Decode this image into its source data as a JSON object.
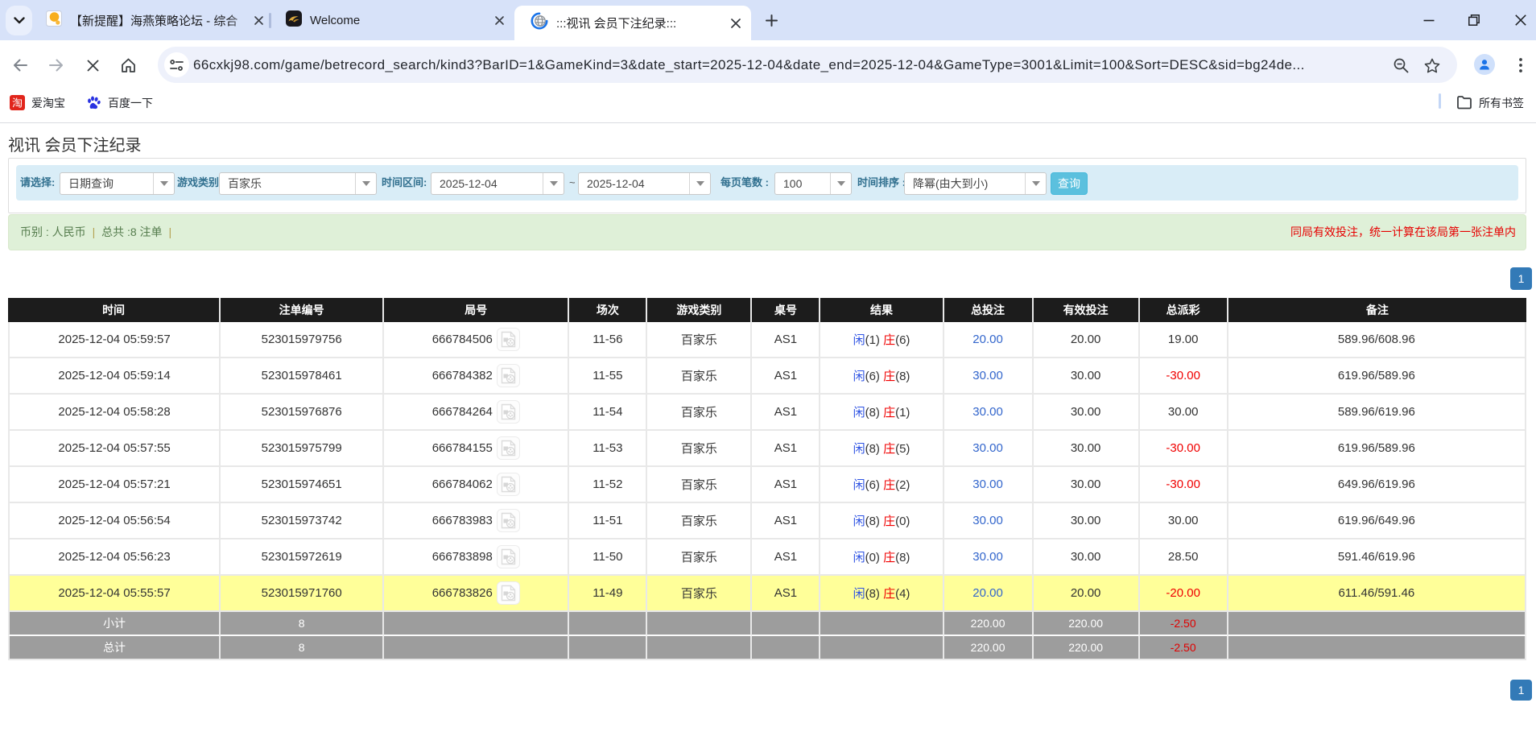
{
  "colors": {
    "tabstrip_bg": "#d7e2f9",
    "accent_blue": "#337ab7",
    "search_button_blue": "#5bc0de",
    "filter_bg": "#d9edf7",
    "summary_bg": "#dff0d8",
    "table_header_bg": "#1c1c1c",
    "highlight_row": "#ffff99",
    "footer_row_bg": "#9d9d9d",
    "link_blue": "#3366cc",
    "negative_red": "#f00000",
    "player_blue": "#2e53e3",
    "banker_red": "#f00000"
  },
  "browser": {
    "tabs": [
      {
        "title": "【新提醒】海燕策略论坛 - 综合",
        "favicon": "haiyan-forum-icon",
        "active": false
      },
      {
        "title": "Welcome",
        "favicon": "gold-dragon-icon",
        "active": false
      },
      {
        "title": ":::视讯 会员下注纪录:::",
        "favicon": "loading-spinner-globe-icon",
        "active": true
      }
    ],
    "url": "66cxkj98.com/game/betrecord_search/kind3?BarID=1&GameKind=3&date_start=2025-12-04&date_end=2025-12-04&GameType=3001&Limit=100&Sort=DESC&sid=bg24de...",
    "bookmarks": [
      {
        "label": "爱淘宝",
        "icon": "taobao-icon"
      },
      {
        "label": "百度一下",
        "icon": "baidu-icon"
      }
    ],
    "all_bookmarks_label": "所有书签"
  },
  "page": {
    "title": "视讯 会员下注纪录",
    "filters": {
      "select_label": "请选择:",
      "select_value": "日期查询",
      "game_type_label": "游戏类别",
      "game_type_value": "百家乐",
      "date_range_label": "时间区间:",
      "date_start": "2025-12-04",
      "date_separator": "~",
      "date_end": "2025-12-04",
      "page_size_label": "每页笔数 :",
      "page_size_value": "100",
      "sort_label": "时间排序 :",
      "sort_value": "降幂(由大到小)",
      "search_button": "查询"
    },
    "summary": {
      "currency_text": "币别 : 人民币 ",
      "pipe1": "|",
      "total_text": " 总共 :8 注单 ",
      "pipe2": "|",
      "note_right": "同局有效投注，统一计算在该局第一张注单内"
    },
    "pagination": {
      "page": "1"
    },
    "table": {
      "headers": [
        "时间",
        "注单编号",
        "局号",
        "场次",
        "游戏类别",
        "桌号",
        "结果",
        "总投注",
        "有效投注",
        "总派彩",
        "备注"
      ],
      "rows": [
        {
          "time": "2025-12-04 05:59:57",
          "bet_id": "523015979756",
          "round": "666784506",
          "session": "11-56",
          "game": "百家乐",
          "table_no": "AS1",
          "result": {
            "player_label": "闲",
            "player_pts": "(1)",
            "banker_label": "庄",
            "banker_pts": "(6)"
          },
          "total_bet": "20.00",
          "valid_bet": "20.00",
          "payout": "19.00",
          "payout_negative": false,
          "note": "589.96/608.96",
          "highlight": false
        },
        {
          "time": "2025-12-04 05:59:14",
          "bet_id": "523015978461",
          "round": "666784382",
          "session": "11-55",
          "game": "百家乐",
          "table_no": "AS1",
          "result": {
            "player_label": "闲",
            "player_pts": "(6)",
            "banker_label": "庄",
            "banker_pts": "(8)"
          },
          "total_bet": "30.00",
          "valid_bet": "30.00",
          "payout": "-30.00",
          "payout_negative": true,
          "note": "619.96/589.96",
          "highlight": false
        },
        {
          "time": "2025-12-04 05:58:28",
          "bet_id": "523015976876",
          "round": "666784264",
          "session": "11-54",
          "game": "百家乐",
          "table_no": "AS1",
          "result": {
            "player_label": "闲",
            "player_pts": "(8)",
            "banker_label": "庄",
            "banker_pts": "(1)"
          },
          "total_bet": "30.00",
          "valid_bet": "30.00",
          "payout": "30.00",
          "payout_negative": false,
          "note": "589.96/619.96",
          "highlight": false
        },
        {
          "time": "2025-12-04 05:57:55",
          "bet_id": "523015975799",
          "round": "666784155",
          "session": "11-53",
          "game": "百家乐",
          "table_no": "AS1",
          "result": {
            "player_label": "闲",
            "player_pts": "(8)",
            "banker_label": "庄",
            "banker_pts": "(5)"
          },
          "total_bet": "30.00",
          "valid_bet": "30.00",
          "payout": "-30.00",
          "payout_negative": true,
          "note": "619.96/589.96",
          "highlight": false
        },
        {
          "time": "2025-12-04 05:57:21",
          "bet_id": "523015974651",
          "round": "666784062",
          "session": "11-52",
          "game": "百家乐",
          "table_no": "AS1",
          "result": {
            "player_label": "闲",
            "player_pts": "(6)",
            "banker_label": "庄",
            "banker_pts": "(2)"
          },
          "total_bet": "30.00",
          "valid_bet": "30.00",
          "payout": "-30.00",
          "payout_negative": true,
          "note": "649.96/619.96",
          "highlight": false
        },
        {
          "time": "2025-12-04 05:56:54",
          "bet_id": "523015973742",
          "round": "666783983",
          "session": "11-51",
          "game": "百家乐",
          "table_no": "AS1",
          "result": {
            "player_label": "闲",
            "player_pts": "(8)",
            "banker_label": "庄",
            "banker_pts": "(0)"
          },
          "total_bet": "30.00",
          "valid_bet": "30.00",
          "payout": "30.00",
          "payout_negative": false,
          "note": "619.96/649.96",
          "highlight": false
        },
        {
          "time": "2025-12-04 05:56:23",
          "bet_id": "523015972619",
          "round": "666783898",
          "session": "11-50",
          "game": "百家乐",
          "table_no": "AS1",
          "result": {
            "player_label": "闲",
            "player_pts": "(0)",
            "banker_label": "庄",
            "banker_pts": "(8)"
          },
          "total_bet": "30.00",
          "valid_bet": "30.00",
          "payout": "28.50",
          "payout_negative": false,
          "note": "591.46/619.96",
          "highlight": false
        },
        {
          "time": "2025-12-04 05:55:57",
          "bet_id": "523015971760",
          "round": "666783826",
          "session": "11-49",
          "game": "百家乐",
          "table_no": "AS1",
          "result": {
            "player_label": "闲",
            "player_pts": "(8)",
            "banker_label": "庄",
            "banker_pts": "(4)"
          },
          "total_bet": "20.00",
          "valid_bet": "20.00",
          "payout": "-20.00",
          "payout_negative": true,
          "note": "611.46/591.46",
          "highlight": true
        }
      ],
      "subtotal": {
        "label": "小计",
        "count": "8",
        "total_bet": "220.00",
        "valid_bet": "220.00",
        "payout": "-2.50"
      },
      "total": {
        "label": "总计",
        "count": "8",
        "total_bet": "220.00",
        "valid_bet": "220.00",
        "payout": "-2.50"
      }
    }
  }
}
